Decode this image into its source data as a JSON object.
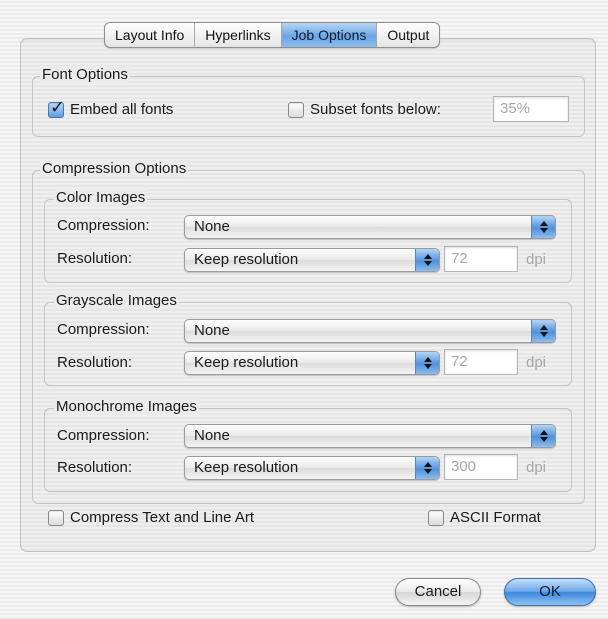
{
  "tabs": [
    {
      "label": "Layout Info",
      "active": false
    },
    {
      "label": "Hyperlinks",
      "active": false
    },
    {
      "label": "Job Options",
      "active": true
    },
    {
      "label": "Output",
      "active": false
    }
  ],
  "font_options": {
    "title": "Font Options",
    "embed_all_fonts": {
      "label": "Embed all fonts",
      "checked": true
    },
    "subset_fonts": {
      "label": "Subset fonts below:",
      "checked": false,
      "value": "35%"
    }
  },
  "compression_options": {
    "title": "Compression Options",
    "color": {
      "title": "Color Images",
      "compression_label": "Compression:",
      "compression_value": "None",
      "resolution_label": "Resolution:",
      "resolution_value": "Keep resolution",
      "dpi_value": "72",
      "dpi_unit": "dpi"
    },
    "grayscale": {
      "title": "Grayscale Images",
      "compression_label": "Compression:",
      "compression_value": "None",
      "resolution_label": "Resolution:",
      "resolution_value": "Keep resolution",
      "dpi_value": "72",
      "dpi_unit": "dpi"
    },
    "monochrome": {
      "title": "Monochrome Images",
      "compression_label": "Compression:",
      "compression_value": "None",
      "resolution_label": "Resolution:",
      "resolution_value": "Keep resolution",
      "dpi_value": "300",
      "dpi_unit": "dpi"
    }
  },
  "compress_text": {
    "label": "Compress Text and Line Art",
    "checked": false
  },
  "ascii_format": {
    "label": "ASCII Format",
    "checked": false
  },
  "buttons": {
    "cancel": "Cancel",
    "ok": "OK"
  },
  "colors": {
    "accent": "#5e9ee2",
    "disabled_text": "#a8a8a8"
  }
}
